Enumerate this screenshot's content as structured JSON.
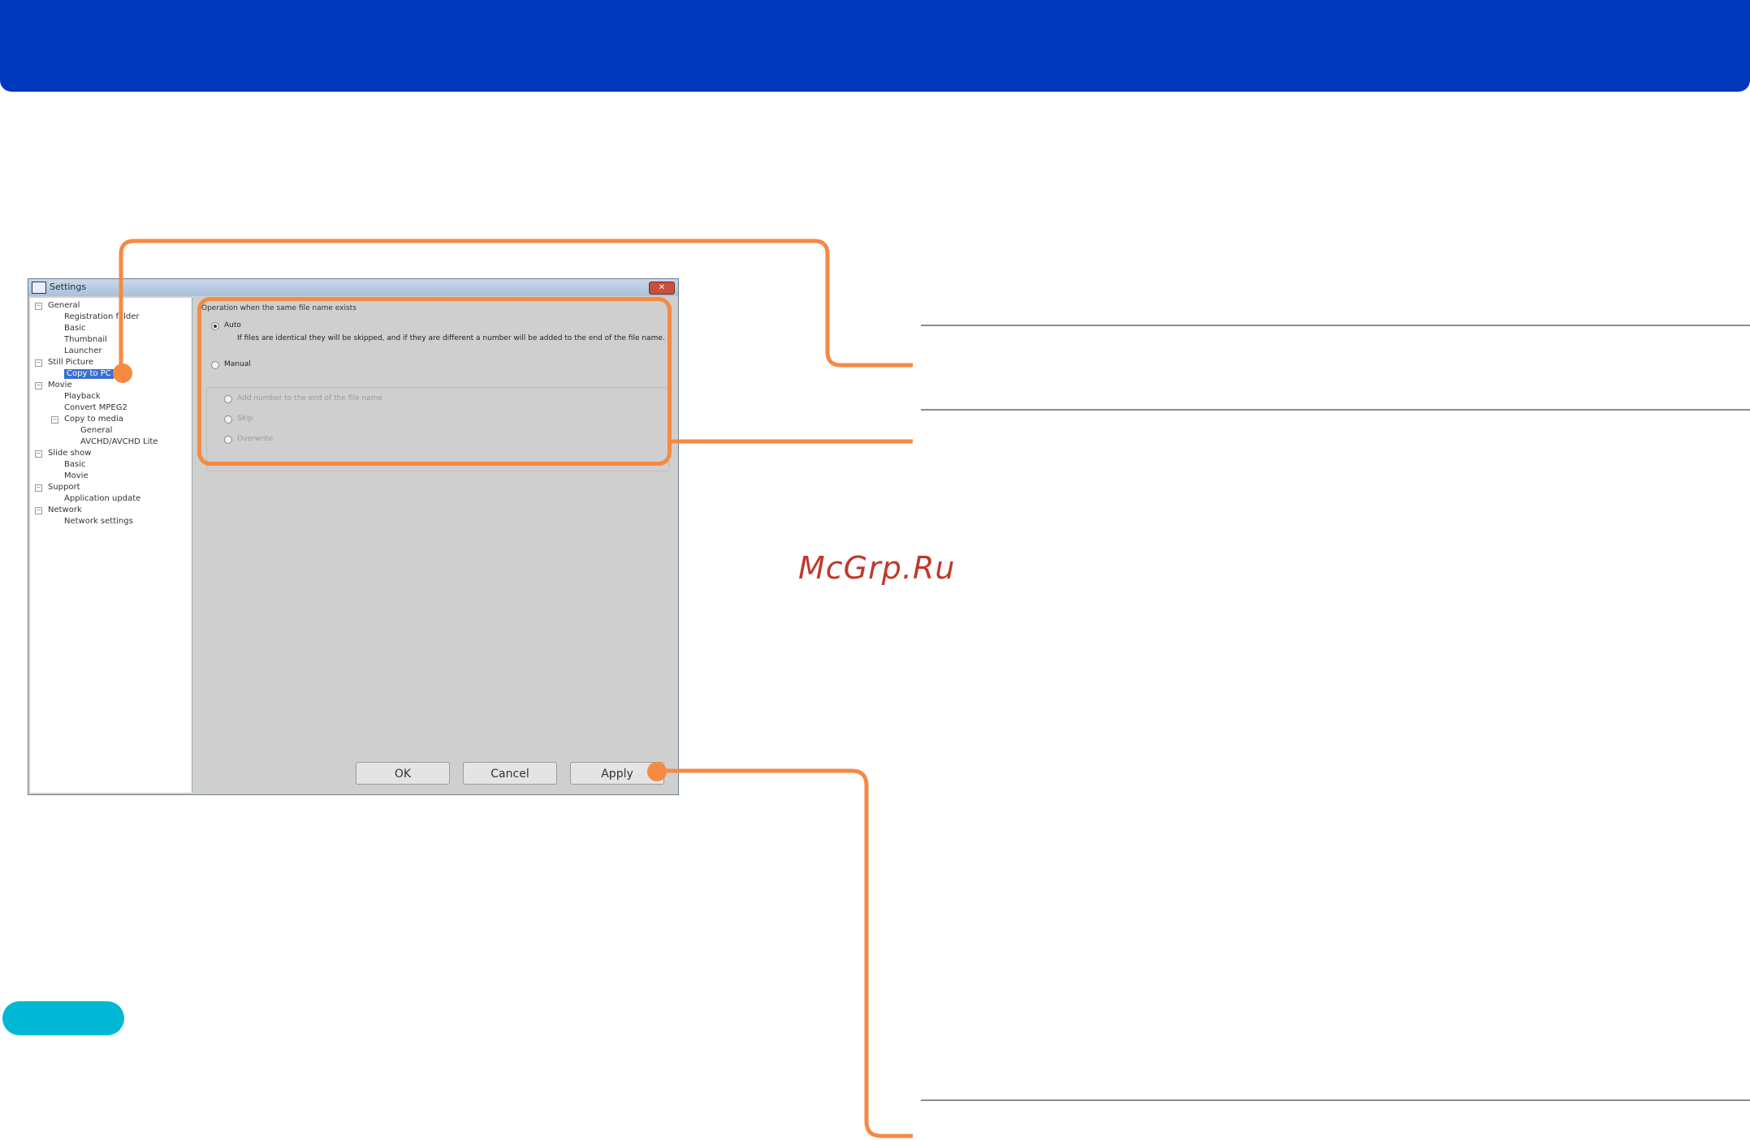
{
  "header": {
    "title": ""
  },
  "window": {
    "title": "Settings",
    "close_glyph": "✕",
    "tree": [
      {
        "label": "General",
        "level": 0,
        "toggle": "−"
      },
      {
        "label": "Registration folder",
        "level": 1
      },
      {
        "label": "Basic",
        "level": 1
      },
      {
        "label": "Thumbnail",
        "level": 1
      },
      {
        "label": "Launcher",
        "level": 1
      },
      {
        "label": "Still Picture",
        "level": 0,
        "toggle": "−"
      },
      {
        "label": "Copy to PC",
        "level": 1,
        "selected": true
      },
      {
        "label": "Movie",
        "level": 0,
        "toggle": "−"
      },
      {
        "label": "Playback",
        "level": 1
      },
      {
        "label": "Convert MPEG2",
        "level": 1
      },
      {
        "label": "Copy to media",
        "level": 1,
        "toggle": "−"
      },
      {
        "label": "General",
        "level": 2
      },
      {
        "label": "AVCHD/AVCHD Lite",
        "level": 2
      },
      {
        "label": "Slide show",
        "level": 0,
        "toggle": "−"
      },
      {
        "label": "Basic",
        "level": 1
      },
      {
        "label": "Movie",
        "level": 1
      },
      {
        "label": "Support",
        "level": 0,
        "toggle": "−"
      },
      {
        "label": "Application update",
        "level": 1
      },
      {
        "label": "Network",
        "level": 0,
        "toggle": "−"
      },
      {
        "label": "Network settings",
        "level": 1
      }
    ],
    "panel": {
      "group_label": "Operation when the same file name exists",
      "auto_label": "Auto",
      "auto_desc": "If files are identical they will be skipped, and if they are different a number will be added to the end of the file name.",
      "manual_label": "Manual",
      "manual_options": [
        "Add number to the end of the file name",
        "Skip",
        "Overwrite"
      ]
    },
    "buttons": {
      "ok": "OK",
      "cancel": "Cancel",
      "apply": "Apply"
    }
  },
  "watermark": "McGrp.Ru",
  "colors": {
    "header": "#0038bd",
    "callout": "#f58a42",
    "pill": "#00b8d4"
  }
}
